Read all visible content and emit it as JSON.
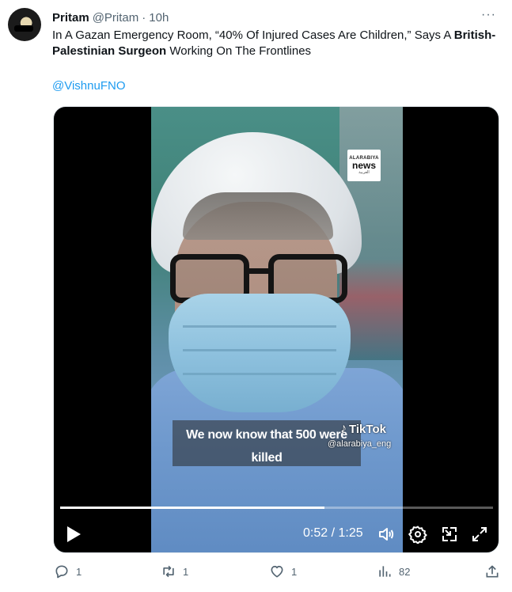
{
  "tweet": {
    "author_name": "Pritam",
    "author_handle": "@Pritam",
    "time": "10h",
    "text_part1": "In A Gazan Emergency Room, “40% Of Injured Cases Are Children,” Says A ",
    "text_bold": "British-Palestinian Surgeon",
    "text_part2": " Working On The Frontlines",
    "mention": "@VishnuFNO",
    "more_label": "···"
  },
  "video": {
    "watermark": {
      "line1": "ALARABIYA",
      "line2": "news",
      "line3": "العربية"
    },
    "caption_line1": "We now know that 500 were",
    "caption_line2": "killed",
    "tiktok_label": "TikTok",
    "tiktok_handle": "@alarabiya_eng",
    "current_time": "0:52",
    "duration": "1:25",
    "time_display": "0:52 / 1:25",
    "progress": 0.61
  },
  "actions": {
    "reply_count": "1",
    "retweet_count": "1",
    "like_count": "1",
    "views_count": "82"
  },
  "colors": {
    "link": "#1d9bf0",
    "muted": "#536471",
    "text": "#0f1419"
  }
}
